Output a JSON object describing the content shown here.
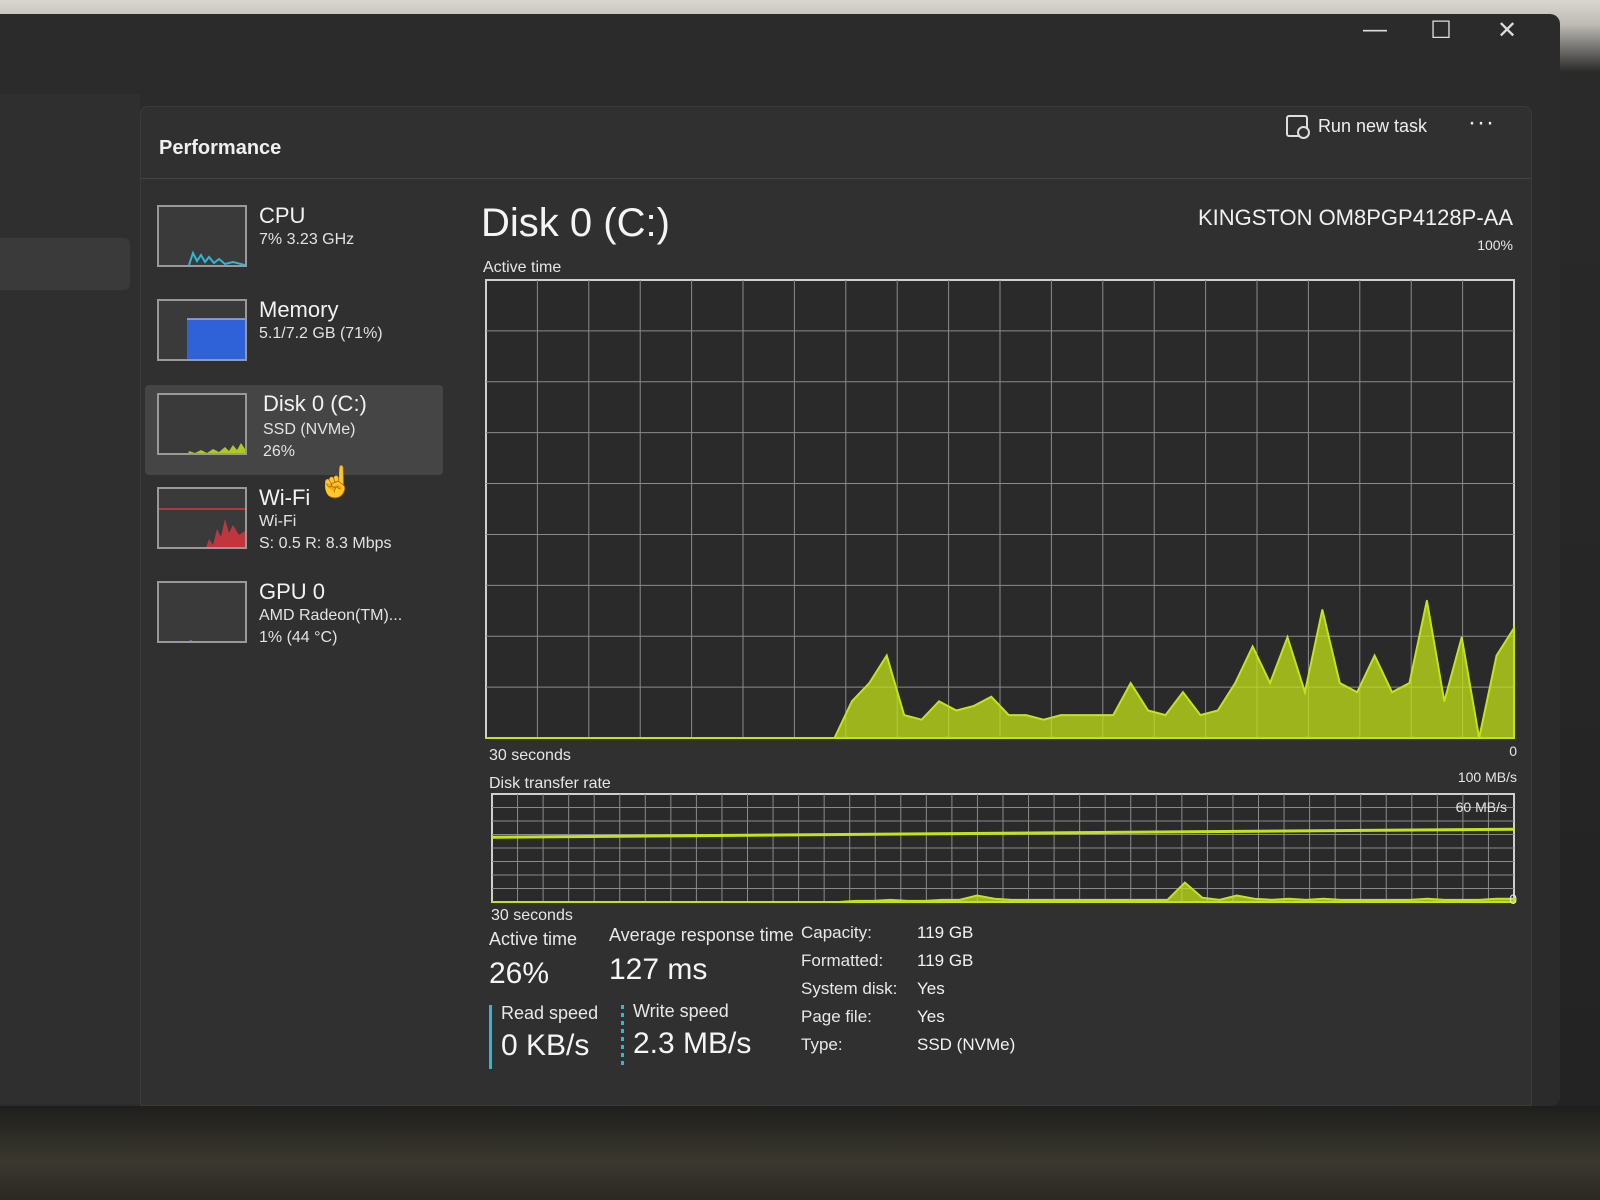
{
  "window": {
    "controls": [
      "—",
      "☐",
      "✕"
    ]
  },
  "header": {
    "title": "Performance",
    "run_new_task": "Run new task",
    "more": "···"
  },
  "side_list": [
    {
      "name": "CPU",
      "line1": "7% 3.23 GHz",
      "line2": "",
      "color": "#2fb7d6"
    },
    {
      "name": "Memory",
      "line1": "5.1/7.2 GB (71%)",
      "line2": "",
      "color": "#2f62d9"
    },
    {
      "name": "Disk 0 (C:)",
      "line1": "SSD (NVMe)",
      "line2": "26%",
      "color": "#c4e319"
    },
    {
      "name": "Wi-Fi",
      "line1": "Wi-Fi",
      "line2": "S: 0.5 R: 8.3 Mbps",
      "color": "#d9363e"
    },
    {
      "name": "GPU 0",
      "line1": "AMD Radeon(TM)...",
      "line2": "1% (44 °C)",
      "color": "#8a5cd0"
    }
  ],
  "main": {
    "title": "Disk 0 (C:)",
    "model": "KINGSTON OM8PGP4128P-AA",
    "active_chart": {
      "label": "Active time",
      "max_label": "100%",
      "min_label": "0",
      "time_label": "30 seconds"
    },
    "transfer_chart": {
      "label": "Disk transfer rate",
      "max_label": "100 MB/s",
      "line_label": "60 MB/s",
      "min_label": "0",
      "time_label": "30 seconds"
    }
  },
  "chart_data": [
    {
      "type": "area",
      "title": "Active time",
      "ylim": [
        0,
        100
      ],
      "x": [
        0,
        1,
        2,
        3,
        4,
        5,
        6,
        7,
        8,
        9,
        10,
        11,
        12,
        13,
        14,
        15,
        16,
        17,
        18,
        19,
        20,
        21,
        22,
        23,
        24,
        25,
        26,
        27,
        28,
        29,
        30,
        31,
        32,
        33,
        34,
        35,
        36,
        37,
        38,
        39,
        40,
        41,
        42,
        43,
        44,
        45,
        46,
        47,
        48,
        49,
        50,
        51,
        52,
        53,
        54,
        55,
        56,
        57,
        58,
        59
      ],
      "series": [
        {
          "values": [
            0,
            0,
            0,
            0,
            0,
            0,
            0,
            0,
            0,
            0,
            0,
            0,
            0,
            0,
            0,
            0,
            0,
            0,
            0,
            0,
            0,
            8,
            12,
            18,
            5,
            4,
            8,
            6,
            7,
            9,
            5,
            5,
            4,
            5,
            5,
            5,
            5,
            12,
            6,
            5,
            10,
            5,
            6,
            12,
            20,
            12,
            22,
            10,
            28,
            12,
            10,
            18,
            10,
            12,
            30,
            8,
            22,
            0,
            18,
            24
          ]
        }
      ],
      "color": "#c4e319"
    },
    {
      "type": "area",
      "title": "Disk transfer rate",
      "ylim": [
        0,
        100
      ],
      "x": [
        0,
        1,
        2,
        3,
        4,
        5,
        6,
        7,
        8,
        9,
        10,
        11,
        12,
        13,
        14,
        15,
        16,
        17,
        18,
        19,
        20,
        21,
        22,
        23,
        24,
        25,
        26,
        27,
        28,
        29,
        30,
        31,
        32,
        33,
        34,
        35,
        36,
        37,
        38,
        39,
        40,
        41,
        42,
        43,
        44,
        45,
        46,
        47,
        48,
        49,
        50,
        51,
        52,
        53,
        54,
        55,
        56,
        57,
        58,
        59
      ],
      "series": [
        {
          "values": [
            0,
            0,
            0,
            0,
            0,
            0,
            0,
            0,
            0,
            0,
            0,
            0,
            0,
            0,
            0,
            0,
            0,
            0,
            0,
            0,
            0,
            1,
            1,
            2,
            1,
            1,
            2,
            2,
            6,
            3,
            2,
            2,
            2,
            2,
            2,
            2,
            2,
            2,
            2,
            2,
            18,
            4,
            2,
            6,
            3,
            2,
            3,
            2,
            3,
            2,
            2,
            2,
            2,
            2,
            3,
            2,
            2,
            2,
            3,
            3
          ]
        }
      ],
      "reference_line": 60,
      "color": "#c4e319"
    }
  ],
  "stats": {
    "active_time_label": "Active time",
    "active_time_value": "26%",
    "avg_response_label": "Average response time",
    "avg_response_value": "127 ms",
    "read_speed_label": "Read speed",
    "read_speed_value": "0 KB/s",
    "write_speed_label": "Write speed",
    "write_speed_value": "2.3 MB/s",
    "properties": [
      {
        "label": "Capacity:",
        "value": "119 GB"
      },
      {
        "label": "Formatted:",
        "value": "119 GB"
      },
      {
        "label": "System disk:",
        "value": "Yes"
      },
      {
        "label": "Page file:",
        "value": "Yes"
      },
      {
        "label": "Type:",
        "value": "SSD (NVMe)"
      }
    ]
  }
}
